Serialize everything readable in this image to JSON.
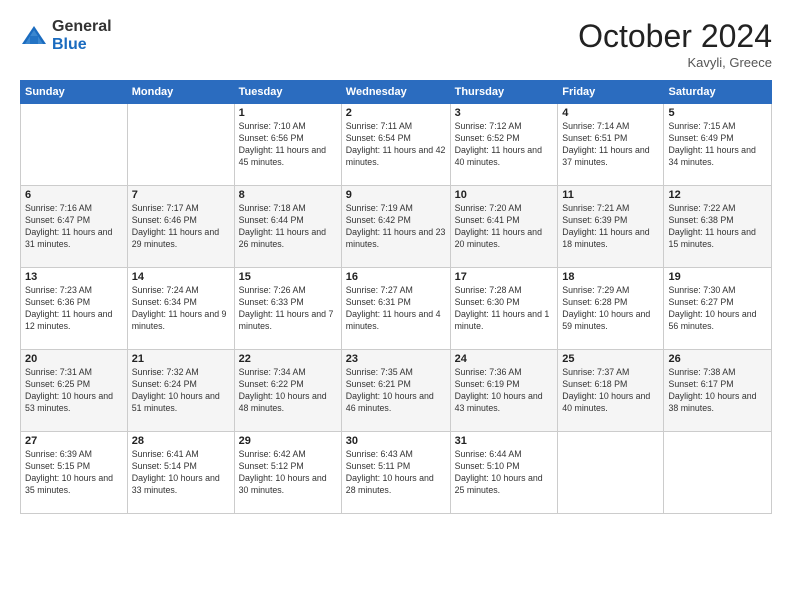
{
  "logo": {
    "general": "General",
    "blue": "Blue"
  },
  "title": "October 2024",
  "location": "Kavyli, Greece",
  "days_of_week": [
    "Sunday",
    "Monday",
    "Tuesday",
    "Wednesday",
    "Thursday",
    "Friday",
    "Saturday"
  ],
  "weeks": [
    [
      {
        "day": "",
        "detail": ""
      },
      {
        "day": "",
        "detail": ""
      },
      {
        "day": "1",
        "detail": "Sunrise: 7:10 AM\nSunset: 6:56 PM\nDaylight: 11 hours and 45 minutes."
      },
      {
        "day": "2",
        "detail": "Sunrise: 7:11 AM\nSunset: 6:54 PM\nDaylight: 11 hours and 42 minutes."
      },
      {
        "day": "3",
        "detail": "Sunrise: 7:12 AM\nSunset: 6:52 PM\nDaylight: 11 hours and 40 minutes."
      },
      {
        "day": "4",
        "detail": "Sunrise: 7:14 AM\nSunset: 6:51 PM\nDaylight: 11 hours and 37 minutes."
      },
      {
        "day": "5",
        "detail": "Sunrise: 7:15 AM\nSunset: 6:49 PM\nDaylight: 11 hours and 34 minutes."
      }
    ],
    [
      {
        "day": "6",
        "detail": "Sunrise: 7:16 AM\nSunset: 6:47 PM\nDaylight: 11 hours and 31 minutes."
      },
      {
        "day": "7",
        "detail": "Sunrise: 7:17 AM\nSunset: 6:46 PM\nDaylight: 11 hours and 29 minutes."
      },
      {
        "day": "8",
        "detail": "Sunrise: 7:18 AM\nSunset: 6:44 PM\nDaylight: 11 hours and 26 minutes."
      },
      {
        "day": "9",
        "detail": "Sunrise: 7:19 AM\nSunset: 6:42 PM\nDaylight: 11 hours and 23 minutes."
      },
      {
        "day": "10",
        "detail": "Sunrise: 7:20 AM\nSunset: 6:41 PM\nDaylight: 11 hours and 20 minutes."
      },
      {
        "day": "11",
        "detail": "Sunrise: 7:21 AM\nSunset: 6:39 PM\nDaylight: 11 hours and 18 minutes."
      },
      {
        "day": "12",
        "detail": "Sunrise: 7:22 AM\nSunset: 6:38 PM\nDaylight: 11 hours and 15 minutes."
      }
    ],
    [
      {
        "day": "13",
        "detail": "Sunrise: 7:23 AM\nSunset: 6:36 PM\nDaylight: 11 hours and 12 minutes."
      },
      {
        "day": "14",
        "detail": "Sunrise: 7:24 AM\nSunset: 6:34 PM\nDaylight: 11 hours and 9 minutes."
      },
      {
        "day": "15",
        "detail": "Sunrise: 7:26 AM\nSunset: 6:33 PM\nDaylight: 11 hours and 7 minutes."
      },
      {
        "day": "16",
        "detail": "Sunrise: 7:27 AM\nSunset: 6:31 PM\nDaylight: 11 hours and 4 minutes."
      },
      {
        "day": "17",
        "detail": "Sunrise: 7:28 AM\nSunset: 6:30 PM\nDaylight: 11 hours and 1 minute."
      },
      {
        "day": "18",
        "detail": "Sunrise: 7:29 AM\nSunset: 6:28 PM\nDaylight: 10 hours and 59 minutes."
      },
      {
        "day": "19",
        "detail": "Sunrise: 7:30 AM\nSunset: 6:27 PM\nDaylight: 10 hours and 56 minutes."
      }
    ],
    [
      {
        "day": "20",
        "detail": "Sunrise: 7:31 AM\nSunset: 6:25 PM\nDaylight: 10 hours and 53 minutes."
      },
      {
        "day": "21",
        "detail": "Sunrise: 7:32 AM\nSunset: 6:24 PM\nDaylight: 10 hours and 51 minutes."
      },
      {
        "day": "22",
        "detail": "Sunrise: 7:34 AM\nSunset: 6:22 PM\nDaylight: 10 hours and 48 minutes."
      },
      {
        "day": "23",
        "detail": "Sunrise: 7:35 AM\nSunset: 6:21 PM\nDaylight: 10 hours and 46 minutes."
      },
      {
        "day": "24",
        "detail": "Sunrise: 7:36 AM\nSunset: 6:19 PM\nDaylight: 10 hours and 43 minutes."
      },
      {
        "day": "25",
        "detail": "Sunrise: 7:37 AM\nSunset: 6:18 PM\nDaylight: 10 hours and 40 minutes."
      },
      {
        "day": "26",
        "detail": "Sunrise: 7:38 AM\nSunset: 6:17 PM\nDaylight: 10 hours and 38 minutes."
      }
    ],
    [
      {
        "day": "27",
        "detail": "Sunrise: 6:39 AM\nSunset: 5:15 PM\nDaylight: 10 hours and 35 minutes."
      },
      {
        "day": "28",
        "detail": "Sunrise: 6:41 AM\nSunset: 5:14 PM\nDaylight: 10 hours and 33 minutes."
      },
      {
        "day": "29",
        "detail": "Sunrise: 6:42 AM\nSunset: 5:12 PM\nDaylight: 10 hours and 30 minutes."
      },
      {
        "day": "30",
        "detail": "Sunrise: 6:43 AM\nSunset: 5:11 PM\nDaylight: 10 hours and 28 minutes."
      },
      {
        "day": "31",
        "detail": "Sunrise: 6:44 AM\nSunset: 5:10 PM\nDaylight: 10 hours and 25 minutes."
      },
      {
        "day": "",
        "detail": ""
      },
      {
        "day": "",
        "detail": ""
      }
    ]
  ]
}
